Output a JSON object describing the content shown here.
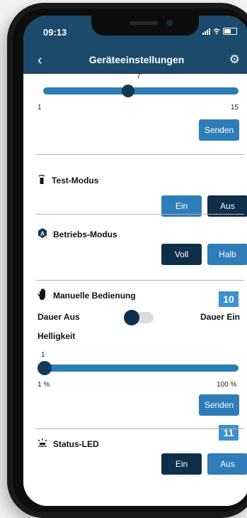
{
  "status_bar": {
    "time": "09:13"
  },
  "header": {
    "title": "Geräteeinstellungen"
  },
  "top_slider": {
    "min_label": "1",
    "max_label": "15",
    "value_label": "7",
    "level": 0.43,
    "send_label": "Senden"
  },
  "test_modus": {
    "title": "Test-Modus",
    "on_label": "Ein",
    "off_label": "Aus"
  },
  "betriebs_modus": {
    "title": "Betriebs-Modus",
    "full_label": "Voll",
    "half_label": "Halb"
  },
  "manual": {
    "badge": "10",
    "title": "Manuelle Bedienung",
    "off_label": "Dauer Aus",
    "on_label": "Dauer Ein",
    "brightness_label": "Helligkeit",
    "brightness_value": "1",
    "min_label": "1 %",
    "max_label": "100 %",
    "level": 0.0,
    "send_label": "Senden"
  },
  "status_led": {
    "badge": "11",
    "title": "Status-LED",
    "on_label": "Ein",
    "off_label": "Aus"
  },
  "colors": {
    "header": "#1b4a6b",
    "button_light": "#2f7db8",
    "button_dark": "#0e2f4a",
    "badge": "#3d8fcf"
  }
}
